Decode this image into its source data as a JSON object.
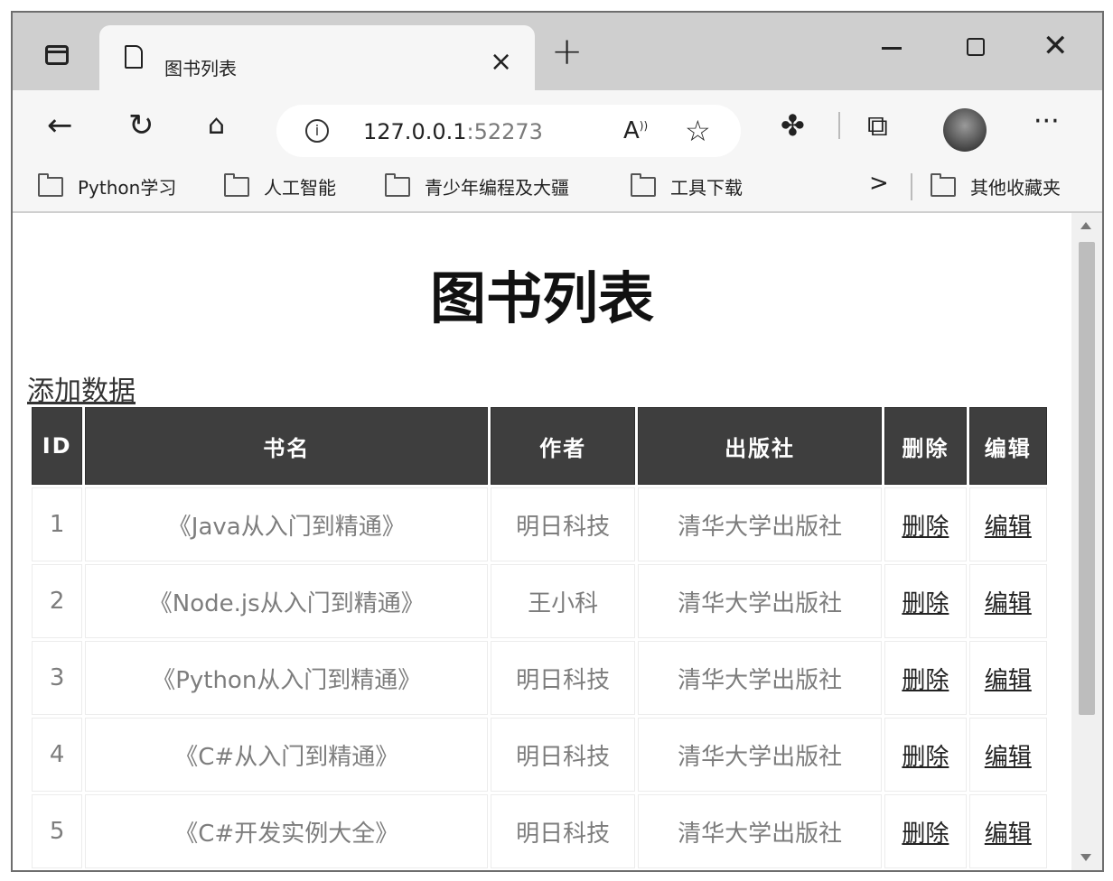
{
  "browser": {
    "tab_title": "图书列表",
    "tab_close": "×",
    "new_tab": "+",
    "address_host": "127.0.0.1",
    "address_port": ":52273",
    "read_aloud": "A",
    "bookmarks": [
      "Python学习",
      "人工智能",
      "青少年编程及大疆",
      "工具下载"
    ],
    "bookmarks_more": ">",
    "other_favorites": "其他收藏夹"
  },
  "page": {
    "title": "图书列表",
    "add_link": "添加数据",
    "table": {
      "headers": [
        "ID",
        "书名",
        "作者",
        "出版社",
        "删除",
        "编辑"
      ],
      "rows": [
        {
          "id": "1",
          "name": "《Java从入门到精通》",
          "author": "明日科技",
          "publisher": "清华大学出版社",
          "delete": "删除",
          "edit": "编辑"
        },
        {
          "id": "2",
          "name": "《Node.js从入门到精通》",
          "author": "王小科",
          "publisher": "清华大学出版社",
          "delete": "删除",
          "edit": "编辑"
        },
        {
          "id": "3",
          "name": "《Python从入门到精通》",
          "author": "明日科技",
          "publisher": "清华大学出版社",
          "delete": "删除",
          "edit": "编辑"
        },
        {
          "id": "4",
          "name": "《C#从入门到精通》",
          "author": "明日科技",
          "publisher": "清华大学出版社",
          "delete": "删除",
          "edit": "编辑"
        },
        {
          "id": "5",
          "name": "《C#开发实例大全》",
          "author": "明日科技",
          "publisher": "清华大学出版社",
          "delete": "删除",
          "edit": "编辑"
        }
      ]
    }
  },
  "colors": {
    "header_bg": "#3e3e3e",
    "chrome_bg": "#cfcfcf",
    "toolbar_bg": "#f6f6f6"
  },
  "icons": [
    "tab-actions-icon",
    "page-icon",
    "back-arrow-icon",
    "refresh-icon",
    "home-icon",
    "info-icon",
    "read-aloud-icon",
    "add-favorite-icon",
    "extensions-icon",
    "collections-icon",
    "profile-avatar",
    "more-icon",
    "folder-icon"
  ]
}
